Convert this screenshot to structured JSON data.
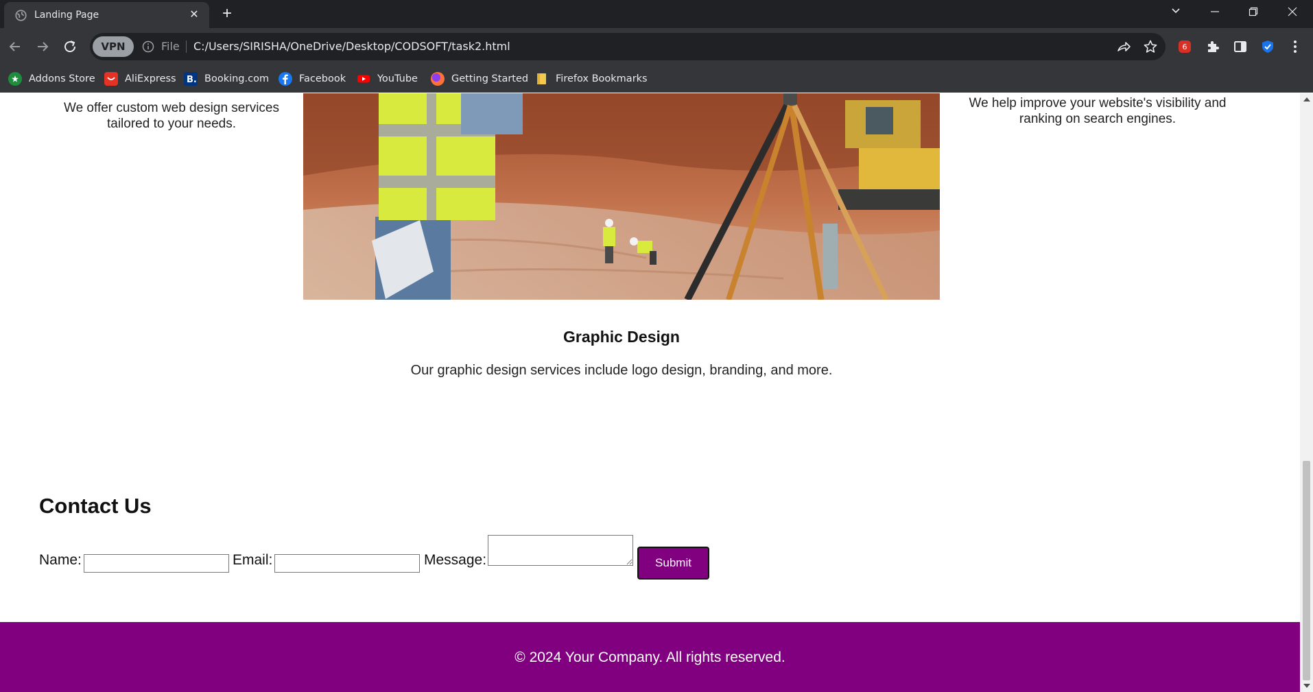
{
  "browser": {
    "tab_title": "Landing Page",
    "vpn_label": "VPN",
    "file_label": "File",
    "url": "C:/Users/SIRISHA/OneDrive/Desktop/CODSOFT/task2.html"
  },
  "bookmarks": [
    {
      "label": "Addons Store",
      "icon": "addons-store-icon",
      "color": "#1e8e3e"
    },
    {
      "label": "AliExpress",
      "icon": "aliexpress-icon",
      "color": "#e43225"
    },
    {
      "label": "Booking.com",
      "icon": "booking-icon",
      "color": "#003580"
    },
    {
      "label": "Facebook",
      "icon": "facebook-icon",
      "color": "#1877f2"
    },
    {
      "label": "YouTube",
      "icon": "youtube-icon",
      "color": "#ff0000"
    },
    {
      "label": "Getting Started",
      "icon": "firefox-icon",
      "color": "#ff7139"
    },
    {
      "label": "Firefox Bookmarks",
      "icon": "folder-icon",
      "color": "#f2c94c"
    }
  ],
  "services": {
    "web_design_desc": "We offer custom web design services tailored to your needs.",
    "seo_desc": "We help improve your website's visibility and ranking on search engines.",
    "graphic_title": "Graphic Design",
    "graphic_desc": "Our graphic design services include logo design, branding, and more."
  },
  "contact": {
    "title": "Contact Us",
    "name_label": "Name:",
    "email_label": "Email:",
    "message_label": "Message:",
    "submit_label": "Submit"
  },
  "footer": {
    "text": "© 2024 Your Company. All rights reserved."
  },
  "colors": {
    "accent": "#800080",
    "chrome_dark": "#202124",
    "chrome_mid": "#35363a"
  }
}
